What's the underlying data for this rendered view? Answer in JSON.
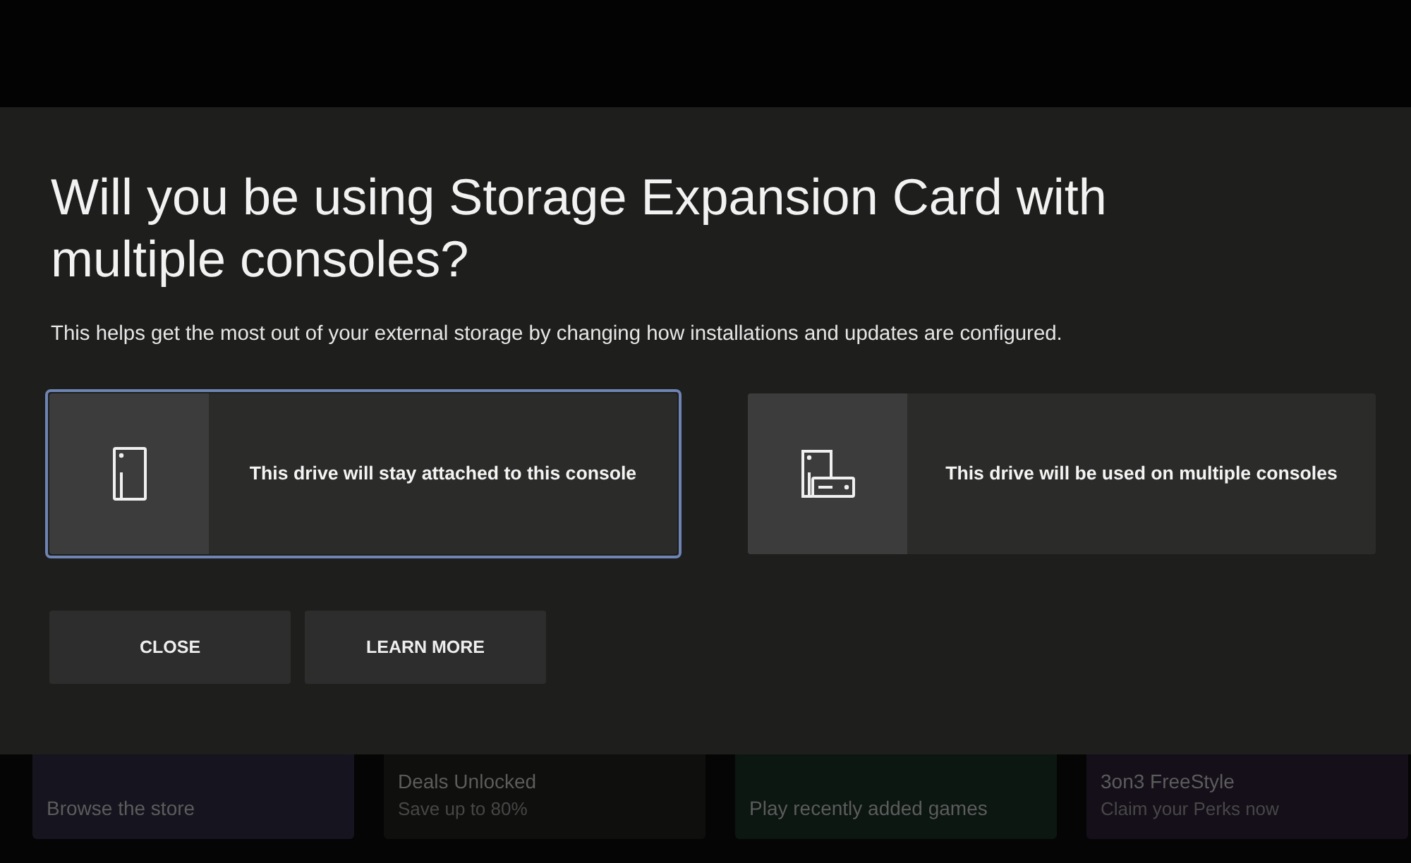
{
  "dialog": {
    "title": "Will you be using Storage Expansion Card with multiple consoles?",
    "description": "This helps get the most out of your external storage by changing how installations and updates are configured.",
    "options": [
      {
        "kind": "single",
        "label": "This drive will stay attached to this console",
        "selected": true
      },
      {
        "kind": "multiple",
        "label": "This drive will be used on multiple consoles",
        "selected": false
      }
    ],
    "buttons": [
      "CLOSE",
      "LEARN MORE"
    ]
  },
  "background_tiles": [
    {
      "title": "Browse the store"
    },
    {
      "title": "Deals Unlocked",
      "subtitle": "Save up to 80%"
    },
    {
      "title": "Play recently added games"
    },
    {
      "title": "3on3 FreeStyle",
      "subtitle": "Claim your Perks now"
    }
  ]
}
